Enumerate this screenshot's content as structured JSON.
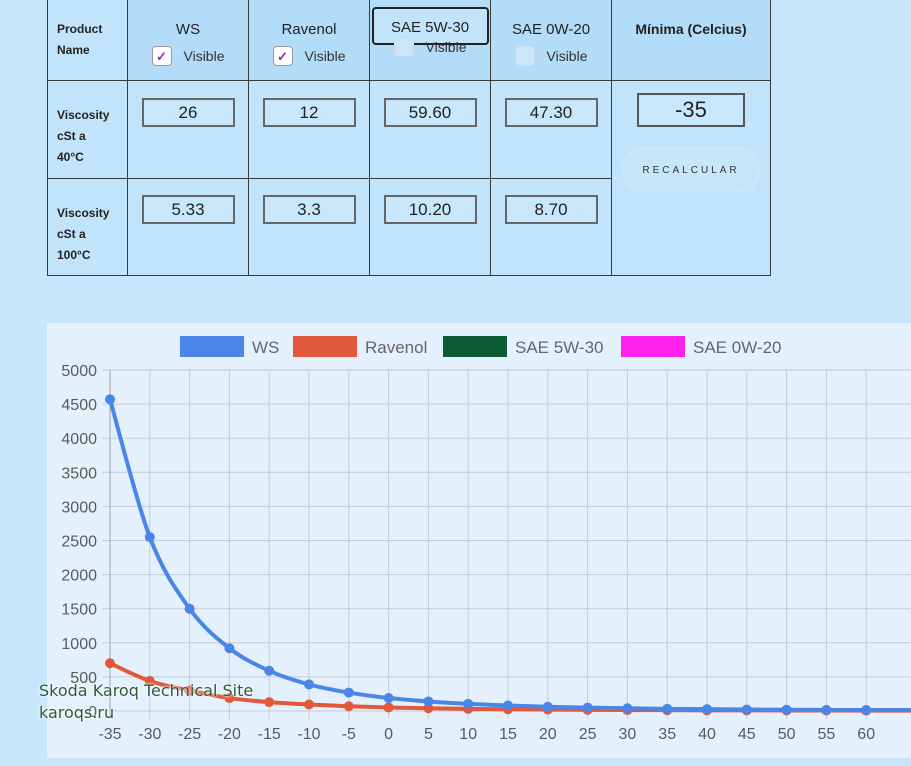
{
  "table": {
    "row_labels": {
      "product_name": [
        "Product",
        "Name"
      ],
      "viscosity40": [
        "Viscosity",
        "cSt a",
        "40°C"
      ],
      "viscosity100": [
        "Viscosity",
        "cSt a",
        "100°C"
      ]
    },
    "columns": [
      {
        "name": "WS",
        "visible_label": "Visible",
        "visible_checked": true,
        "v40": "26",
        "v100": "5.33"
      },
      {
        "name": "Ravenol",
        "visible_label": "Visible",
        "visible_checked": true,
        "v40": "12",
        "v100": "3.3"
      },
      {
        "name": "SAE 5W-30",
        "visible_label": "Visible",
        "visible_checked": false,
        "v40": "59.60",
        "v100": "10.20"
      },
      {
        "name": "SAE 0W-20",
        "visible_label": "Visible",
        "visible_checked": false,
        "v40": "47.30",
        "v100": "8.70"
      }
    ],
    "minima": {
      "header": "Mínima (Celcius)",
      "value": "-35",
      "button_label": "RECALCULAR"
    }
  },
  "watermark": {
    "line1": "Skoda Karoq Technical Site",
    "line2": "karoqs.ru"
  },
  "chart_data": {
    "type": "line",
    "legend_position": "top",
    "grid": true,
    "x": [
      -35,
      -30,
      -25,
      -20,
      -15,
      -10,
      -5,
      0,
      5,
      10,
      15,
      20,
      25,
      30,
      35,
      40,
      45,
      50,
      55,
      60
    ],
    "x_tick_labels": [
      "-35",
      "-30",
      "-25",
      "-20",
      "-15",
      "-10",
      "-5",
      "0",
      "5",
      "10",
      "15",
      "20",
      "25",
      "30",
      "35",
      "40",
      "45",
      "50",
      "55",
      "60"
    ],
    "ylim": [
      0,
      5000
    ],
    "y_ticks": [
      0,
      500,
      1000,
      1500,
      2000,
      2500,
      3000,
      3500,
      4000,
      4500,
      5000
    ],
    "series": [
      {
        "name": "WS",
        "color": "#4a86e8",
        "visible": true,
        "values": [
          4570,
          2550,
          1500,
          920,
          590,
          390,
          270,
          190,
          140,
          105,
          80,
          62,
          50,
          40,
          32,
          27,
          22,
          19,
          16,
          14
        ]
      },
      {
        "name": "Ravenol",
        "color": "#e2583b",
        "visible": true,
        "values": [
          700,
          440,
          300,
          190,
          130,
          95,
          70,
          52,
          40,
          31,
          25,
          20,
          17,
          14,
          12,
          10,
          9,
          8,
          7,
          6
        ]
      },
      {
        "name": "SAE 5W-30",
        "color": "#0c5a36",
        "visible": false,
        "values": []
      },
      {
        "name": "SAE 0W-20",
        "color": "#ff22ee",
        "visible": false,
        "values": []
      }
    ]
  }
}
